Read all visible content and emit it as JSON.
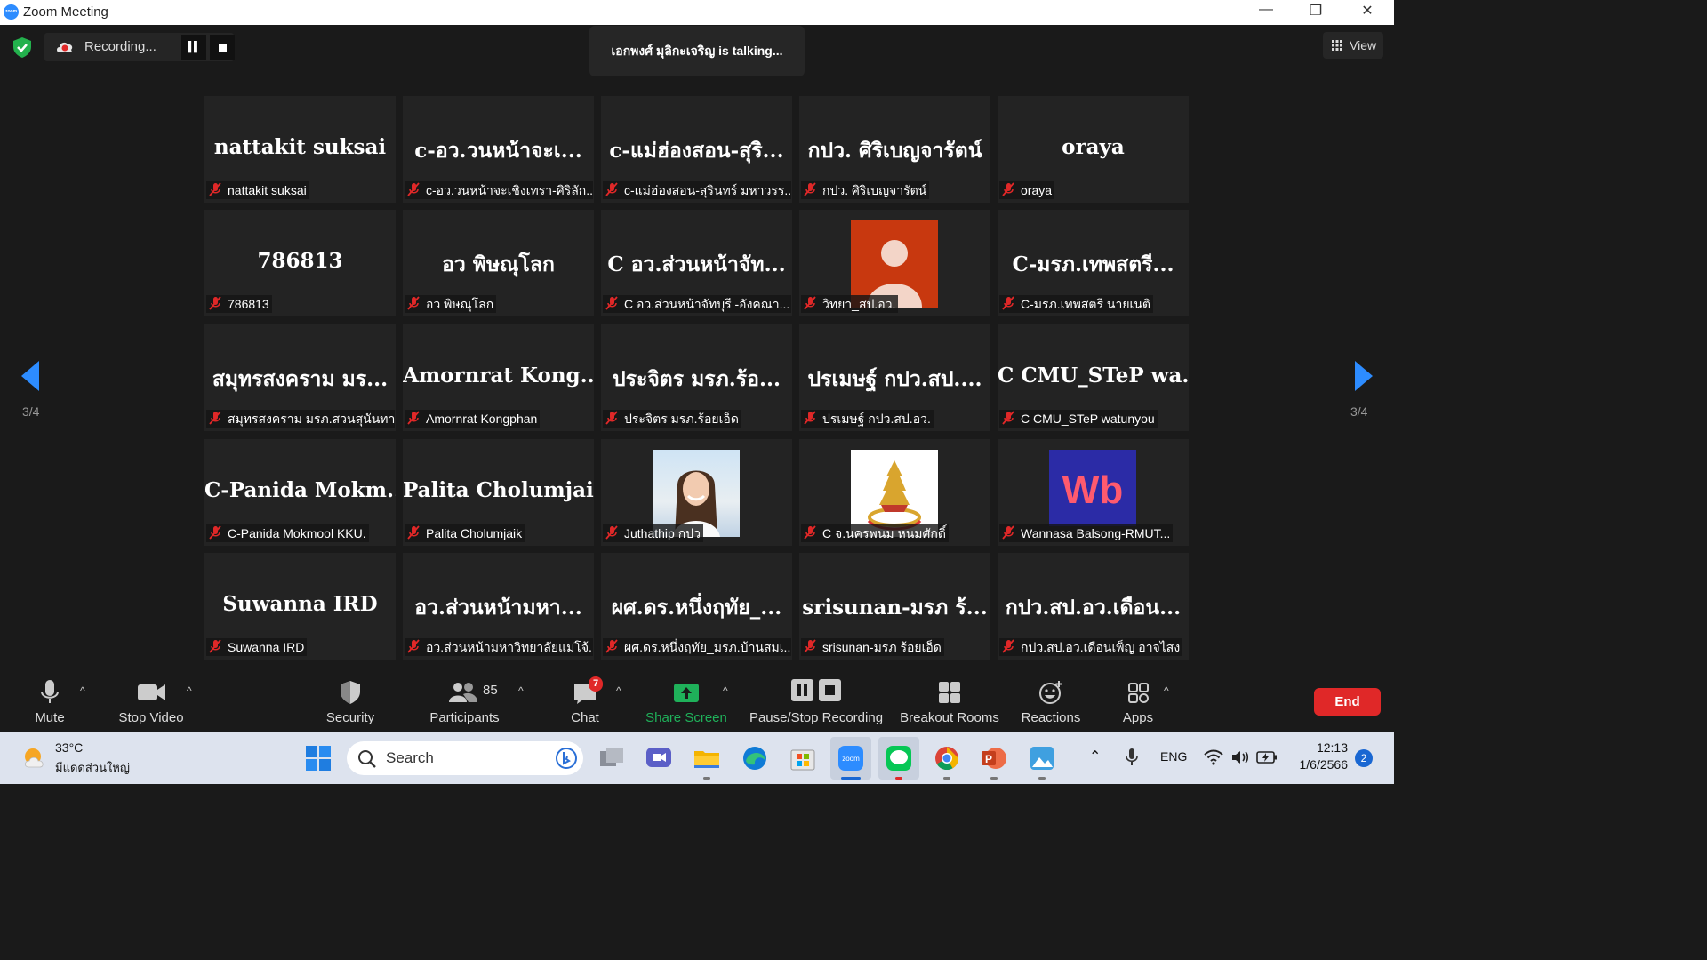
{
  "window": {
    "title": "Zoom Meeting",
    "minimize": "—",
    "restore": "❐",
    "close": "✕"
  },
  "recording": {
    "status": "Recording...",
    "pause": "▌▌"
  },
  "talking": "เอกพงศ์ มุลิกะเจริญ is talking...",
  "view_button": "View",
  "page_indicator": "3/4",
  "participants": [
    {
      "big": "nattakit suksai",
      "label": "nattakit suksai"
    },
    {
      "big": "c-อว.วนหน้าจะเ...",
      "label": "c-อว.วนหน้าจะเชิงเทรา-ศิริลัก..."
    },
    {
      "big": "c-แม่ฮ่องสอน-สุริ...",
      "label": "c-แม่ฮ่องสอน-สุรินทร์ มหาวรร..."
    },
    {
      "big": "กปว. ศิริเบญจารัตน์",
      "label": "กปว. ศิริเบญจารัตน์"
    },
    {
      "big": "oraya",
      "label": "oraya"
    },
    {
      "big": "786813",
      "label": "786813"
    },
    {
      "big": "อว พิษณุโลก",
      "label": "อว พิษณุโลก"
    },
    {
      "big": "C อว.ส่วนหน้าจัท...",
      "label": "C อว.ส่วนหน้าจัทบุรี -อังคณา..."
    },
    {
      "big": "",
      "label": "วิทยา_สป.อว."
    },
    {
      "big": "C-มรภ.เทพสตรี...",
      "label": "C-มรภ.เทพสตรี นายเนติ"
    },
    {
      "big": "สมุทรสงคราม มร...",
      "label": "สมุทรสงคราม มรภ.สวนสุนันทา"
    },
    {
      "big": "Amornrat  Kong...",
      "label": "Amornrat Kongphan"
    },
    {
      "big": "ประจิตร มรภ.ร้อ...",
      "label": "ประจิตร มรภ.ร้อยเอ็ด"
    },
    {
      "big": "ปรเมษฐ์ กปว.สป....",
      "label": "ปรเมษฐ์ กปว.สป.อว."
    },
    {
      "big": "C CMU_STeP  wa...",
      "label": "C CMU_STeP watunyou"
    },
    {
      "big": "C-Panida  Mokm...",
      "label": "C-Panida Mokmool KKU."
    },
    {
      "big": "Palita Cholumjaik",
      "label": "Palita Cholumjaik"
    },
    {
      "big": "",
      "label": "Juthathip กปว"
    },
    {
      "big": "",
      "label": "C จ.นครพนม หนมศักดิ์"
    },
    {
      "big": "",
      "label": "Wannasa Balsong-RMUT..."
    },
    {
      "big": "Suwanna IRD",
      "label": "Suwanna IRD"
    },
    {
      "big": "อว.ส่วนหน้ามหา...",
      "label": "อว.ส่วนหน้ามหาวิทยาลัยแม่โจ้..."
    },
    {
      "big": "ผศ.ดร.หนึ่งฤทัย_...",
      "label": "ผศ.ดร.หนึ่งฤทัย_มรภ.บ้านสมเ..."
    },
    {
      "big": "srisunan-มรภ ร้...",
      "label": "srisunan-มรภ ร้อยเอ็ด"
    },
    {
      "big": "กปว.สป.อว.เดือน...",
      "label": "กปว.สป.อว.เดือนเพ็ญ อาจไสง"
    }
  ],
  "wb_logo_text": "Wb",
  "toolbar": {
    "mute": "Mute",
    "stop_video": "Stop Video",
    "security": "Security",
    "participants": "Participants",
    "participants_count": "85",
    "chat": "Chat",
    "chat_badge": "7",
    "share_screen": "Share Screen",
    "pause_stop_recording": "Pause/Stop Recording",
    "breakout_rooms": "Breakout Rooms",
    "reactions": "Reactions",
    "apps": "Apps",
    "end": "End"
  },
  "taskbar": {
    "weather_temp": "33°C",
    "weather_desc": "มีแดดส่วนใหญ่",
    "search_placeholder": "Search",
    "language": "ENG",
    "time": "12:13",
    "date": "1/6/2566",
    "notifications": "2"
  },
  "colors": {
    "accent": "#2D8CFF",
    "end": "#E02828",
    "share": "#1FB15A",
    "mic_off": "#E02828",
    "avatar_bg": "#C8380F"
  }
}
